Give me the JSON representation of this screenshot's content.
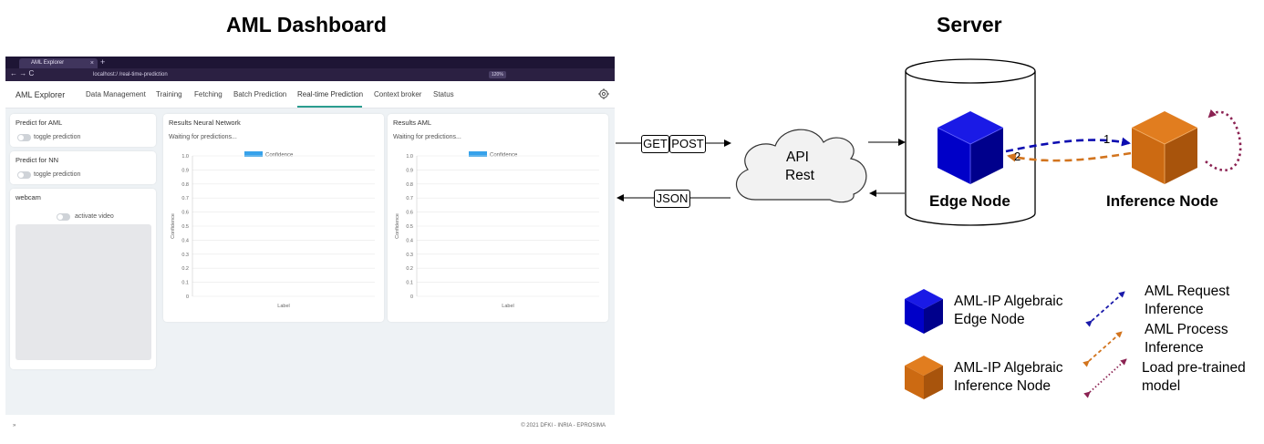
{
  "headings": {
    "dashboard": "AML Dashboard",
    "server": "Server"
  },
  "browser": {
    "tab_title": "AML Explorer",
    "tab_close": "×",
    "new_tab": "+",
    "nav_arrows": "← → C",
    "url": "localhost:/ /real-time-prediction",
    "zoom": "120%"
  },
  "app": {
    "brand": "AML Explorer",
    "nav": [
      {
        "label": "Data Management"
      },
      {
        "label": "Training"
      },
      {
        "label": "Fetching"
      },
      {
        "label": "Batch Prediction"
      },
      {
        "label": "Real-time Prediction"
      },
      {
        "label": "Context broker"
      },
      {
        "label": "Status"
      }
    ],
    "settings_icon": "gear-icon",
    "predict_aml": {
      "title": "Predict for AML",
      "toggle_label": "toggle prediction"
    },
    "predict_nn": {
      "title": "Predict for NN",
      "toggle_label": "toggle prediction"
    },
    "webcam": {
      "title": "webcam",
      "toggle_label": "activate video"
    },
    "results_nn": {
      "title": "Results Neural Network",
      "status": "Waiting for predictions..."
    },
    "results_aml": {
      "title": "Results AML",
      "status": "Waiting for predictions..."
    },
    "footer": {
      "left": "»",
      "right": "© 2021 DFKI - INRIA - EPROSIMA"
    }
  },
  "chart_data": [
    {
      "type": "bar",
      "categories": [],
      "series": [
        {
          "name": "Confidence",
          "values": []
        }
      ],
      "xlabel": "Label",
      "ylabel": "Confidence",
      "ylim": [
        0,
        1.0
      ],
      "yticks": [
        "0",
        "0.1",
        "0.2",
        "0.3",
        "0.4",
        "0.5",
        "0.6",
        "0.7",
        "0.8",
        "0.9",
        "1.0"
      ],
      "legend": "top-center",
      "color": "#36a2eb"
    },
    {
      "type": "bar",
      "categories": [],
      "series": [
        {
          "name": "Confidence",
          "values": []
        }
      ],
      "xlabel": "Label",
      "ylabel": "Confidence",
      "ylim": [
        0,
        1.0
      ],
      "yticks": [
        "0",
        "0.1",
        "0.2",
        "0.3",
        "0.4",
        "0.5",
        "0.6",
        "0.7",
        "0.8",
        "0.9",
        "1.0"
      ],
      "legend": "top-center",
      "color": "#36a2eb"
    }
  ],
  "diagram": {
    "get": "GET",
    "post": "POST",
    "json": "JSON",
    "api_line1": "API",
    "api_line2": "Rest",
    "edge_node": "Edge Node",
    "inference_node": "Inference Node",
    "step1": "1",
    "step2": "2"
  },
  "legend": {
    "edge_line1": "AML-IP Algebraic",
    "edge_line2": "Edge Node",
    "inference_line1": "AML-IP Algebraic",
    "inference_line2": "Inference Node",
    "request_line1": "AML Request",
    "request_line2": "Inference",
    "process_line1": "AML Process",
    "process_line2": "Inference",
    "load_line1": "Load pre-trained",
    "load_line2": "model"
  },
  "colors": {
    "edge_blue": "#0000cc",
    "inference_orange": "#cc6a12",
    "load_maroon": "#8b2252",
    "request_arrow": "#1a1aaa",
    "process_arrow": "#d2741e"
  }
}
